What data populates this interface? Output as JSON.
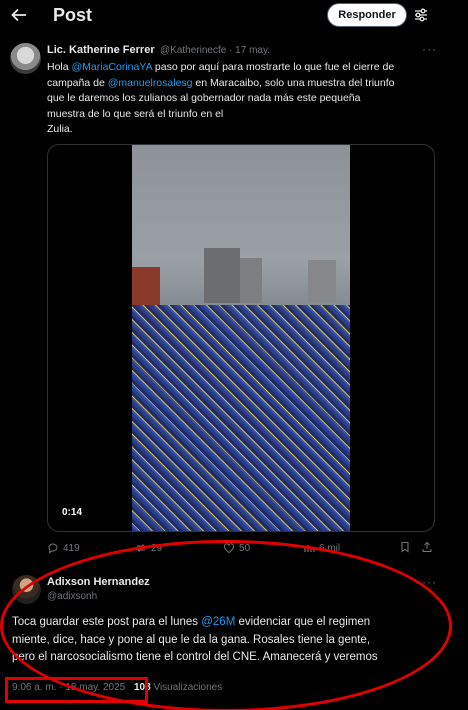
{
  "header": {
    "title": "Post",
    "reply_label": "Responder"
  },
  "post": {
    "author_name": "Lic. Katherine Ferrer",
    "author_handle": "@Katherinecfe · 17 may.",
    "text_lines": [
      [
        "Hola ",
        "@MariaCorinaYA",
        " paso por aquí para mostrarte lo que fue el cierre de"
      ],
      [
        "campaña de ",
        "@manuelrosalesg",
        " en Maracaibo, solo una muestra del triunfo"
      ],
      [
        "que le daremos los zulianos  al gobernador nada más este pequeña",
        "",
        ""
      ],
      [
        "muestra de lo que será el triunfo en el",
        "",
        ""
      ],
      [
        "Zulia.",
        "",
        ""
      ]
    ],
    "video_time": "0:14",
    "actions": {
      "replies": "419",
      "reposts": "29",
      "likes": "50",
      "views": "6 mil"
    }
  },
  "reply": {
    "author_name": "Adixson Hernandez",
    "author_handle": "@adixsonh",
    "text_lines": [
      [
        "Toca guardar este post para el lunes ",
        "@26M",
        " evidenciar que el regimen"
      ],
      [
        "miente, dice, hace y pone al que le da la gana. Rosales tiene la gente,",
        "",
        ""
      ],
      [
        "pero el narcosocialismo tiene el control del CNE. Amanecerá y veremos",
        "",
        ""
      ]
    ],
    "timestamp": "9:06 a. m. · 18 may. 2025",
    "views_count": "108",
    "views_label": " Visualizaciones"
  },
  "colors": {
    "accent": "#1d9bf0",
    "annotation": "#e00000",
    "muted": "#71767b"
  }
}
